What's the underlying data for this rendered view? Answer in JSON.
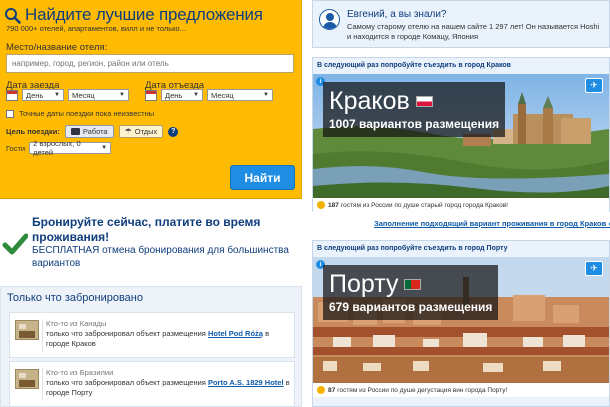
{
  "search": {
    "title": "Найдите лучшие предложения",
    "subtitle": "790 000+ отелей, апартаментов, вилл и не только...",
    "destination_label": "Место/название отеля:",
    "destination_placeholder": "например, город, регион, район или отель",
    "checkin_label": "Дата заезда",
    "checkout_label": "Дата отъезда",
    "day_select": "День",
    "month_select": "Месяц",
    "flexible_dates": "Точные даты поездки пока неизвестны",
    "purpose_label": "Цель поездки:",
    "purpose_work": "Работа",
    "purpose_rest": "Отдых",
    "help": "?",
    "guests_label": "Гости",
    "guests_select": "2 взрослых, 0 детей",
    "find_button": "Найти"
  },
  "promo": {
    "title": "Бронируйте сейчас, платите во время проживания!",
    "body": "БЕСПЛАТНАЯ отмена бронирования для большинства вариантов"
  },
  "recent": {
    "title": "Только что забронировано",
    "items": [
      {
        "who": "Кто-то из Канады",
        "text_before": "только что забронировал объект размещения",
        "link": "Hotel Pod Różą",
        "text_after": "в городе Краков"
      },
      {
        "who": "Кто-то из Бразилии",
        "text_before": "только что забронировал объект размещения",
        "link": "Porto A.S. 1829 Hotel",
        "text_after": "в городе Порту"
      }
    ]
  },
  "tip": {
    "title": "Евгений, а вы знали?",
    "text": "Самому старому отелю на нашем сайте 1 297 лет! Он называется Hoshi и находится в городе Комацу, Япония"
  },
  "destinations": [
    {
      "header": "В следующий раз попробуйте съездить в город Краков",
      "city": "Краков",
      "count": "1007 вариантов размещения",
      "footer_count": "187",
      "footer_text": "гостям из России по душе старый город города Краков!",
      "flag_colors": [
        "#ffffff",
        "#dc143c"
      ]
    },
    {
      "header": "В следующий раз попробуйте съездить в город Порту",
      "city": "Порту",
      "count": "679 вариантов размещения",
      "footer_count": "87",
      "footer_text": "гостям из России по душе дегустация вин города Порту!",
      "flag_colors": [
        "#046a38",
        "#da291c"
      ]
    }
  ],
  "suggest_link": "Заполнение подходящий вариант проживания в город Краков »",
  "colors": {
    "brand_yellow": "#febb02",
    "brand_blue": "#0f3e7d",
    "button_blue": "#1e8de3",
    "check_green": "#2e8b3a"
  }
}
